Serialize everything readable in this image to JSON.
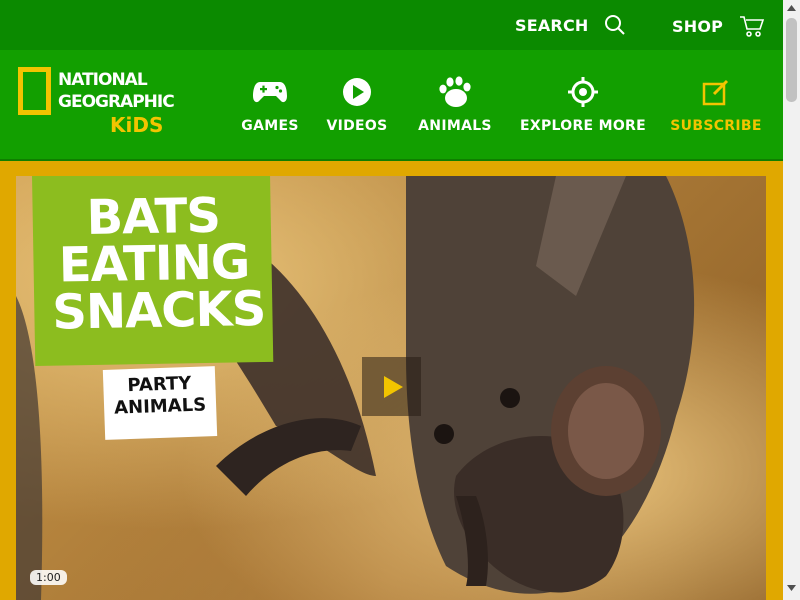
{
  "header": {
    "search_label": "SEARCH",
    "shop_label": "SHOP"
  },
  "logo": {
    "line1": "NATIONAL",
    "line2": "GEOGRAPHIC",
    "line3": "KiDS"
  },
  "nav": {
    "items": [
      {
        "label": "GAMES",
        "icon": "gamepad-icon"
      },
      {
        "label": "VIDEOS",
        "icon": "play-circle-icon"
      },
      {
        "label": "ANIMALS",
        "icon": "paw-icon"
      },
      {
        "label": "EXPLORE MORE",
        "icon": "target-icon"
      },
      {
        "label": "SUBSCRIBE",
        "icon": "edit-square-icon"
      }
    ]
  },
  "hero": {
    "title_line1": "BATS",
    "title_line2": "EATING",
    "title_line3": "SNACKS",
    "subtitle_line1": "PARTY",
    "subtitle_line2": "ANIMALS",
    "duration": "1:00"
  },
  "colors": {
    "top_bar": "#0b8a00",
    "nav_bar": "#129f00",
    "brand_yellow": "#f2c400",
    "badge_green": "#8cbd1f"
  }
}
